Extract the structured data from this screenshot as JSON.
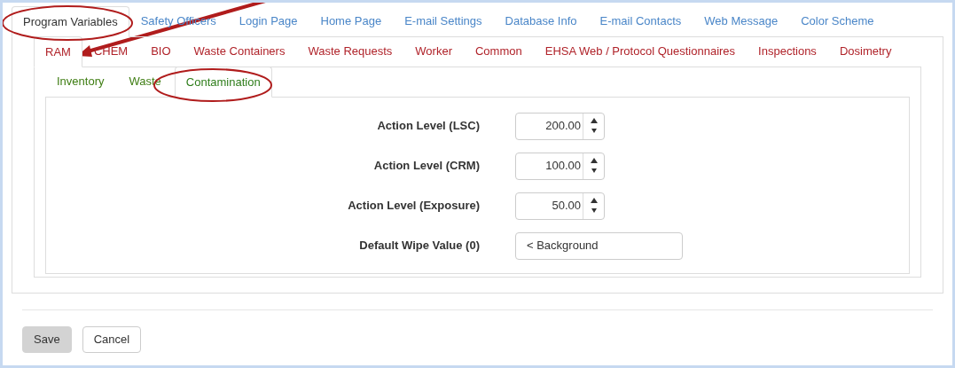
{
  "main_tabs": [
    {
      "label": "Program Variables",
      "selected": true
    },
    {
      "label": "Safety Officers",
      "selected": false
    },
    {
      "label": "Login Page",
      "selected": false
    },
    {
      "label": "Home Page",
      "selected": false
    },
    {
      "label": "E-mail Settings",
      "selected": false
    },
    {
      "label": "Database Info",
      "selected": false
    },
    {
      "label": "E-mail Contacts",
      "selected": false
    },
    {
      "label": "Web Message",
      "selected": false
    },
    {
      "label": "Color Scheme",
      "selected": false
    }
  ],
  "module_tabs": [
    {
      "label": "RAM",
      "selected": true
    },
    {
      "label": "CHEM",
      "selected": false
    },
    {
      "label": "BIO",
      "selected": false
    },
    {
      "label": "Waste Containers",
      "selected": false
    },
    {
      "label": "Waste Requests",
      "selected": false
    },
    {
      "label": "Worker",
      "selected": false
    },
    {
      "label": "Common",
      "selected": false
    },
    {
      "label": "EHSA Web / Protocol Questionnaires",
      "selected": false
    },
    {
      "label": "Inspections",
      "selected": false
    },
    {
      "label": "Dosimetry",
      "selected": false
    }
  ],
  "section_tabs": [
    {
      "label": "Inventory",
      "selected": false
    },
    {
      "label": "Waste",
      "selected": false
    },
    {
      "label": "Contamination",
      "selected": true
    }
  ],
  "fields": [
    {
      "kind": "number",
      "label": "Action Level (LSC)",
      "value": "200.00"
    },
    {
      "kind": "number",
      "label": "Action Level (CRM)",
      "value": "100.00"
    },
    {
      "kind": "number",
      "label": "Action Level (Exposure)",
      "value": "50.00"
    },
    {
      "kind": "text",
      "label": "Default Wipe Value (0)",
      "value": "< Background"
    }
  ],
  "buttons": [
    {
      "kind": "primary",
      "label": "Save"
    },
    {
      "kind": "default",
      "label": "Cancel"
    }
  ]
}
